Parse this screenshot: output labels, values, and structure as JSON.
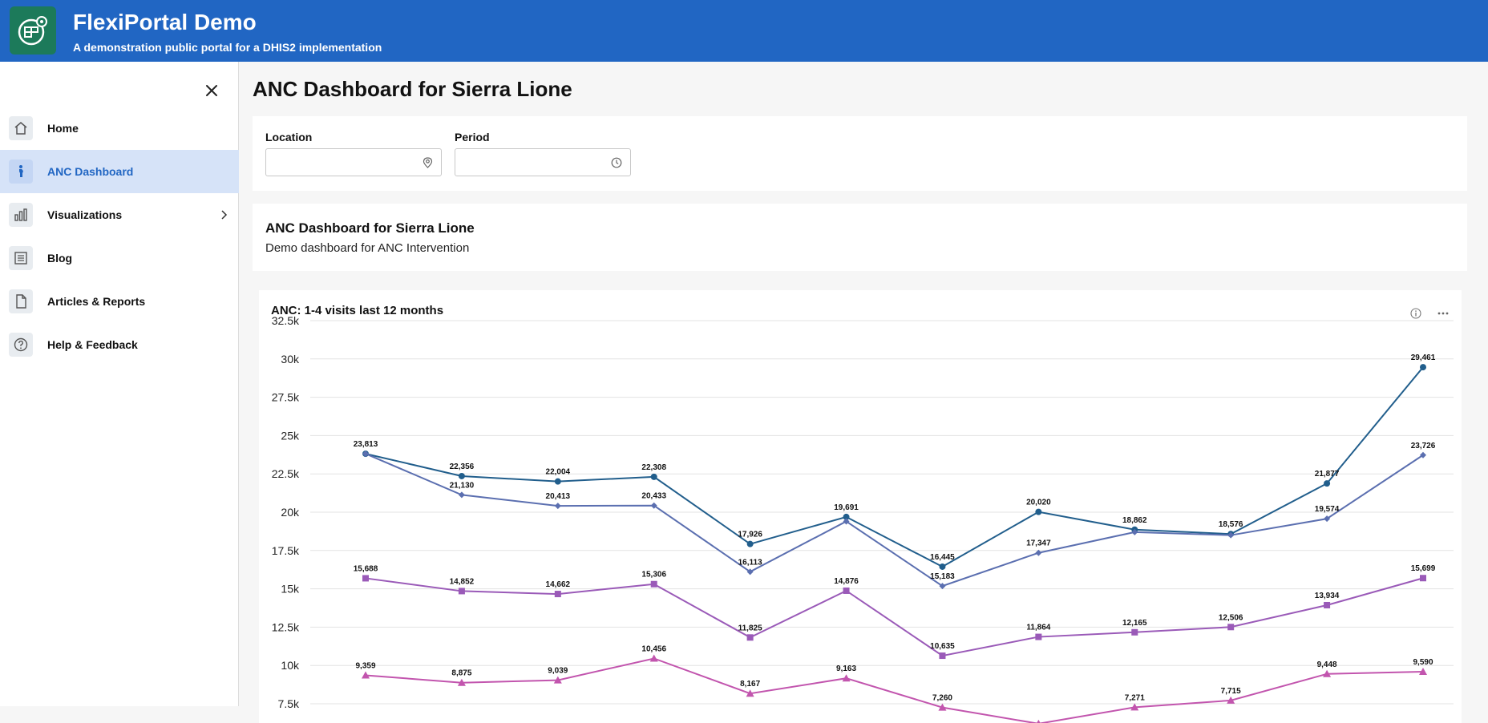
{
  "header": {
    "title": "FlexiPortal Demo",
    "subtitle": "A demonstration public portal for a DHIS2 implementation",
    "logo_icon": "dashboard-gear-logo"
  },
  "sidebar": {
    "close_icon": "close-icon",
    "items": [
      {
        "label": "Home",
        "icon": "home-icon",
        "active": false
      },
      {
        "label": "ANC Dashboard",
        "icon": "pregnant-person-icon",
        "active": true
      },
      {
        "label": "Visualizations",
        "icon": "bar-chart-icon",
        "active": false,
        "has_submenu": true
      },
      {
        "label": "Blog",
        "icon": "article-icon",
        "active": false
      },
      {
        "label": "Articles & Reports",
        "icon": "document-icon",
        "active": false
      },
      {
        "label": "Help & Feedback",
        "icon": "help-icon",
        "active": false
      }
    ]
  },
  "main": {
    "page_title": "ANC Dashboard for Sierra Lione",
    "filters": {
      "location": {
        "label": "Location",
        "value": "",
        "icon": "location-pin-icon"
      },
      "period": {
        "label": "Period",
        "value": "",
        "icon": "clock-icon"
      }
    },
    "dashboard": {
      "title": "ANC Dashboard for Sierra Lione",
      "description": "Demo dashboard for ANC Intervention"
    },
    "chart": {
      "title": "ANC: 1-4 visits last 12 months",
      "actions": [
        "info-icon",
        "more-icon"
      ]
    }
  },
  "colors": {
    "header_bg": "#2166c3",
    "active_nav_bg": "#d6e3f8",
    "active_nav_text": "#2166c3",
    "series": [
      "#215e8c",
      "#5b6fb0",
      "#9a5ab8",
      "#c255ae"
    ]
  },
  "chart_data": {
    "type": "line",
    "title": "ANC: 1-4 visits last 12 months",
    "xlabel": "",
    "ylabel": "",
    "ylim": [
      7500,
      32500
    ],
    "yticks": [
      "7.5k",
      "10k",
      "12.5k",
      "15k",
      "17.5k",
      "20k",
      "22.5k",
      "25k",
      "27.5k",
      "30k",
      "32.5k"
    ],
    "ytick_values": [
      7500,
      10000,
      12500,
      15000,
      17500,
      20000,
      22500,
      25000,
      27500,
      30000,
      32500
    ],
    "grid": true,
    "series": [
      {
        "marker": "circle",
        "color": "#215e8c",
        "values": [
          23813,
          22356,
          22004,
          22308,
          17926,
          19691,
          16445,
          20020,
          18862,
          18576,
          21877,
          29461
        ]
      },
      {
        "marker": "diamond",
        "color": "#5b6fb0",
        "values": [
          23813,
          21130,
          20413,
          20433,
          16113,
          19400,
          15183,
          17347,
          18700,
          18500,
          19574,
          23726
        ]
      },
      {
        "marker": "square",
        "color": "#9a5ab8",
        "values": [
          15688,
          14852,
          14662,
          15306,
          11825,
          14876,
          10635,
          11864,
          12165,
          12506,
          13934,
          15699
        ]
      },
      {
        "marker": "triangle",
        "color": "#c255ae",
        "values": [
          9359,
          8875,
          9039,
          10456,
          8167,
          9163,
          7260,
          6200,
          7271,
          7715,
          9448,
          9590
        ]
      }
    ],
    "data_labels": [
      [
        "23,813",
        "22,356",
        "22,004",
        "22,308",
        "17,926",
        "19,691",
        "16,445",
        "20,020",
        "18,862",
        "18,576",
        "21,877",
        "29,461"
      ],
      [
        "",
        "21,130",
        "20,413",
        "20,433",
        "16,113",
        "",
        "15,183",
        "17,347",
        "",
        "",
        "19,574",
        "23,726"
      ],
      [
        "15,688",
        "14,852",
        "14,662",
        "15,306",
        "11,825",
        "14,876",
        "10,635",
        "11,864",
        "12,165",
        "12,506",
        "13,934",
        "15,699"
      ],
      [
        "9,359",
        "8,875",
        "9,039",
        "10,456",
        "8,167",
        "9,163",
        "7,260",
        "",
        "7,271",
        "7,715",
        "9,448",
        "9,590"
      ]
    ]
  }
}
